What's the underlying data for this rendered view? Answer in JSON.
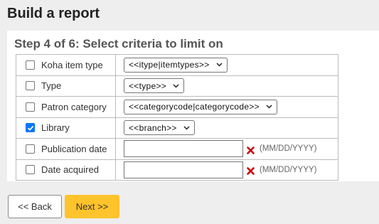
{
  "page": {
    "title": "Build a report"
  },
  "step": {
    "title": "Step 4 of 6: Select criteria to limit on"
  },
  "criteria": [
    {
      "label": "Koha item type",
      "checked": false,
      "kind": "select",
      "value": "<<itype|itemtypes>>"
    },
    {
      "label": "Type",
      "checked": false,
      "kind": "select",
      "value": "<<type>>"
    },
    {
      "label": "Patron category",
      "checked": false,
      "kind": "select",
      "value": "<<categorycode|categorycode>>"
    },
    {
      "label": "Library",
      "checked": true,
      "kind": "select",
      "value": "<<branch>>"
    },
    {
      "label": "Publication date",
      "checked": false,
      "kind": "date",
      "value": "",
      "hint": "(MM/DD/YYYY)"
    },
    {
      "label": "Date acquired",
      "checked": false,
      "kind": "date",
      "value": "",
      "hint": "(MM/DD/YYYY)"
    }
  ],
  "buttons": {
    "back": "<< Back",
    "next": "Next >>"
  },
  "icons": {
    "clear": "clear-date-icon",
    "chevron": "chevron-down-icon",
    "check": "check-icon"
  },
  "colors": {
    "accent": "#ffc32b",
    "checkbox_checked": "#0075ff",
    "clear_icon": "#cc0000"
  }
}
